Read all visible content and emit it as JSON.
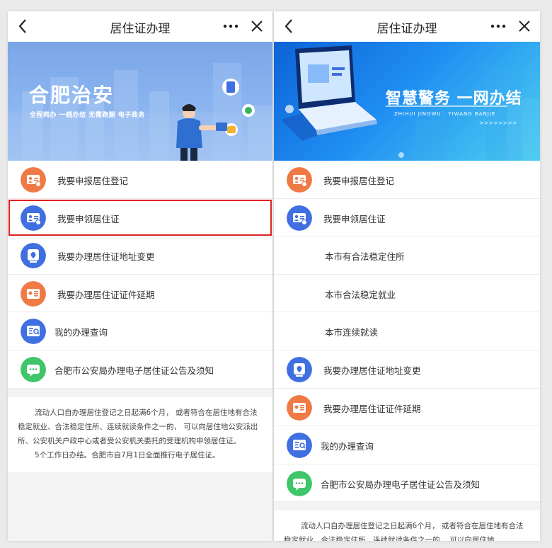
{
  "left": {
    "nav": {
      "title": "居住证办理"
    },
    "banner": {
      "headline": "合肥治安",
      "sub": "全程网办 一趟办结 无需跑腿 电子政务"
    },
    "items": [
      {
        "label": "我要申报居住登记"
      },
      {
        "label": "我要申领居住证"
      },
      {
        "label": "我要办理居住证地址变更"
      },
      {
        "label": "我要办理居住证证件延期"
      },
      {
        "label": "我的办理查询"
      },
      {
        "label": "合肥市公安局办理电子居住证公告及须知"
      }
    ],
    "note": {
      "p1": "流动人口自办理居住登记之日起满6个月， 或者符合在居住地有合法稳定就业、合法稳定住所、连续就读条件之一的， 可以向居住地公安派出所、公安机关户政中心或者受公安机关委托的受理机构申领居住证。",
      "p2": "5个工作日办结。合肥市自7月1日全面推行电子居住证。"
    }
  },
  "right": {
    "nav": {
      "title": "居住证办理"
    },
    "banner": {
      "headline": "智慧警务 一网办结",
      "pinyin": "ZHIHUI JINGWU · YIWANG BANJIE",
      "arrows": ">>>>>>>>"
    },
    "items": [
      {
        "label": "我要申报居住登记"
      },
      {
        "label": "我要申领居住证"
      },
      {
        "label": "本市有合法稳定住所"
      },
      {
        "label": "本市合法稳定就业"
      },
      {
        "label": "本市连续就读"
      },
      {
        "label": "我要办理居住证地址变更"
      },
      {
        "label": "我要办理居住证证件延期"
      },
      {
        "label": "我的办理查询"
      },
      {
        "label": "合肥市公安局办理电子居住证公告及须知"
      }
    ],
    "note": {
      "p1": "流动人口自办理居住登记之日起满6个月， 或者符合在居住地有合法稳定就业、合法稳定住所、连续就读条件之一的， 可以向居住地"
    }
  },
  "colors": {
    "orange": "#f07a45",
    "blue": "#3f6fe0",
    "green": "#3fc56a",
    "highlight": "#e02020"
  }
}
